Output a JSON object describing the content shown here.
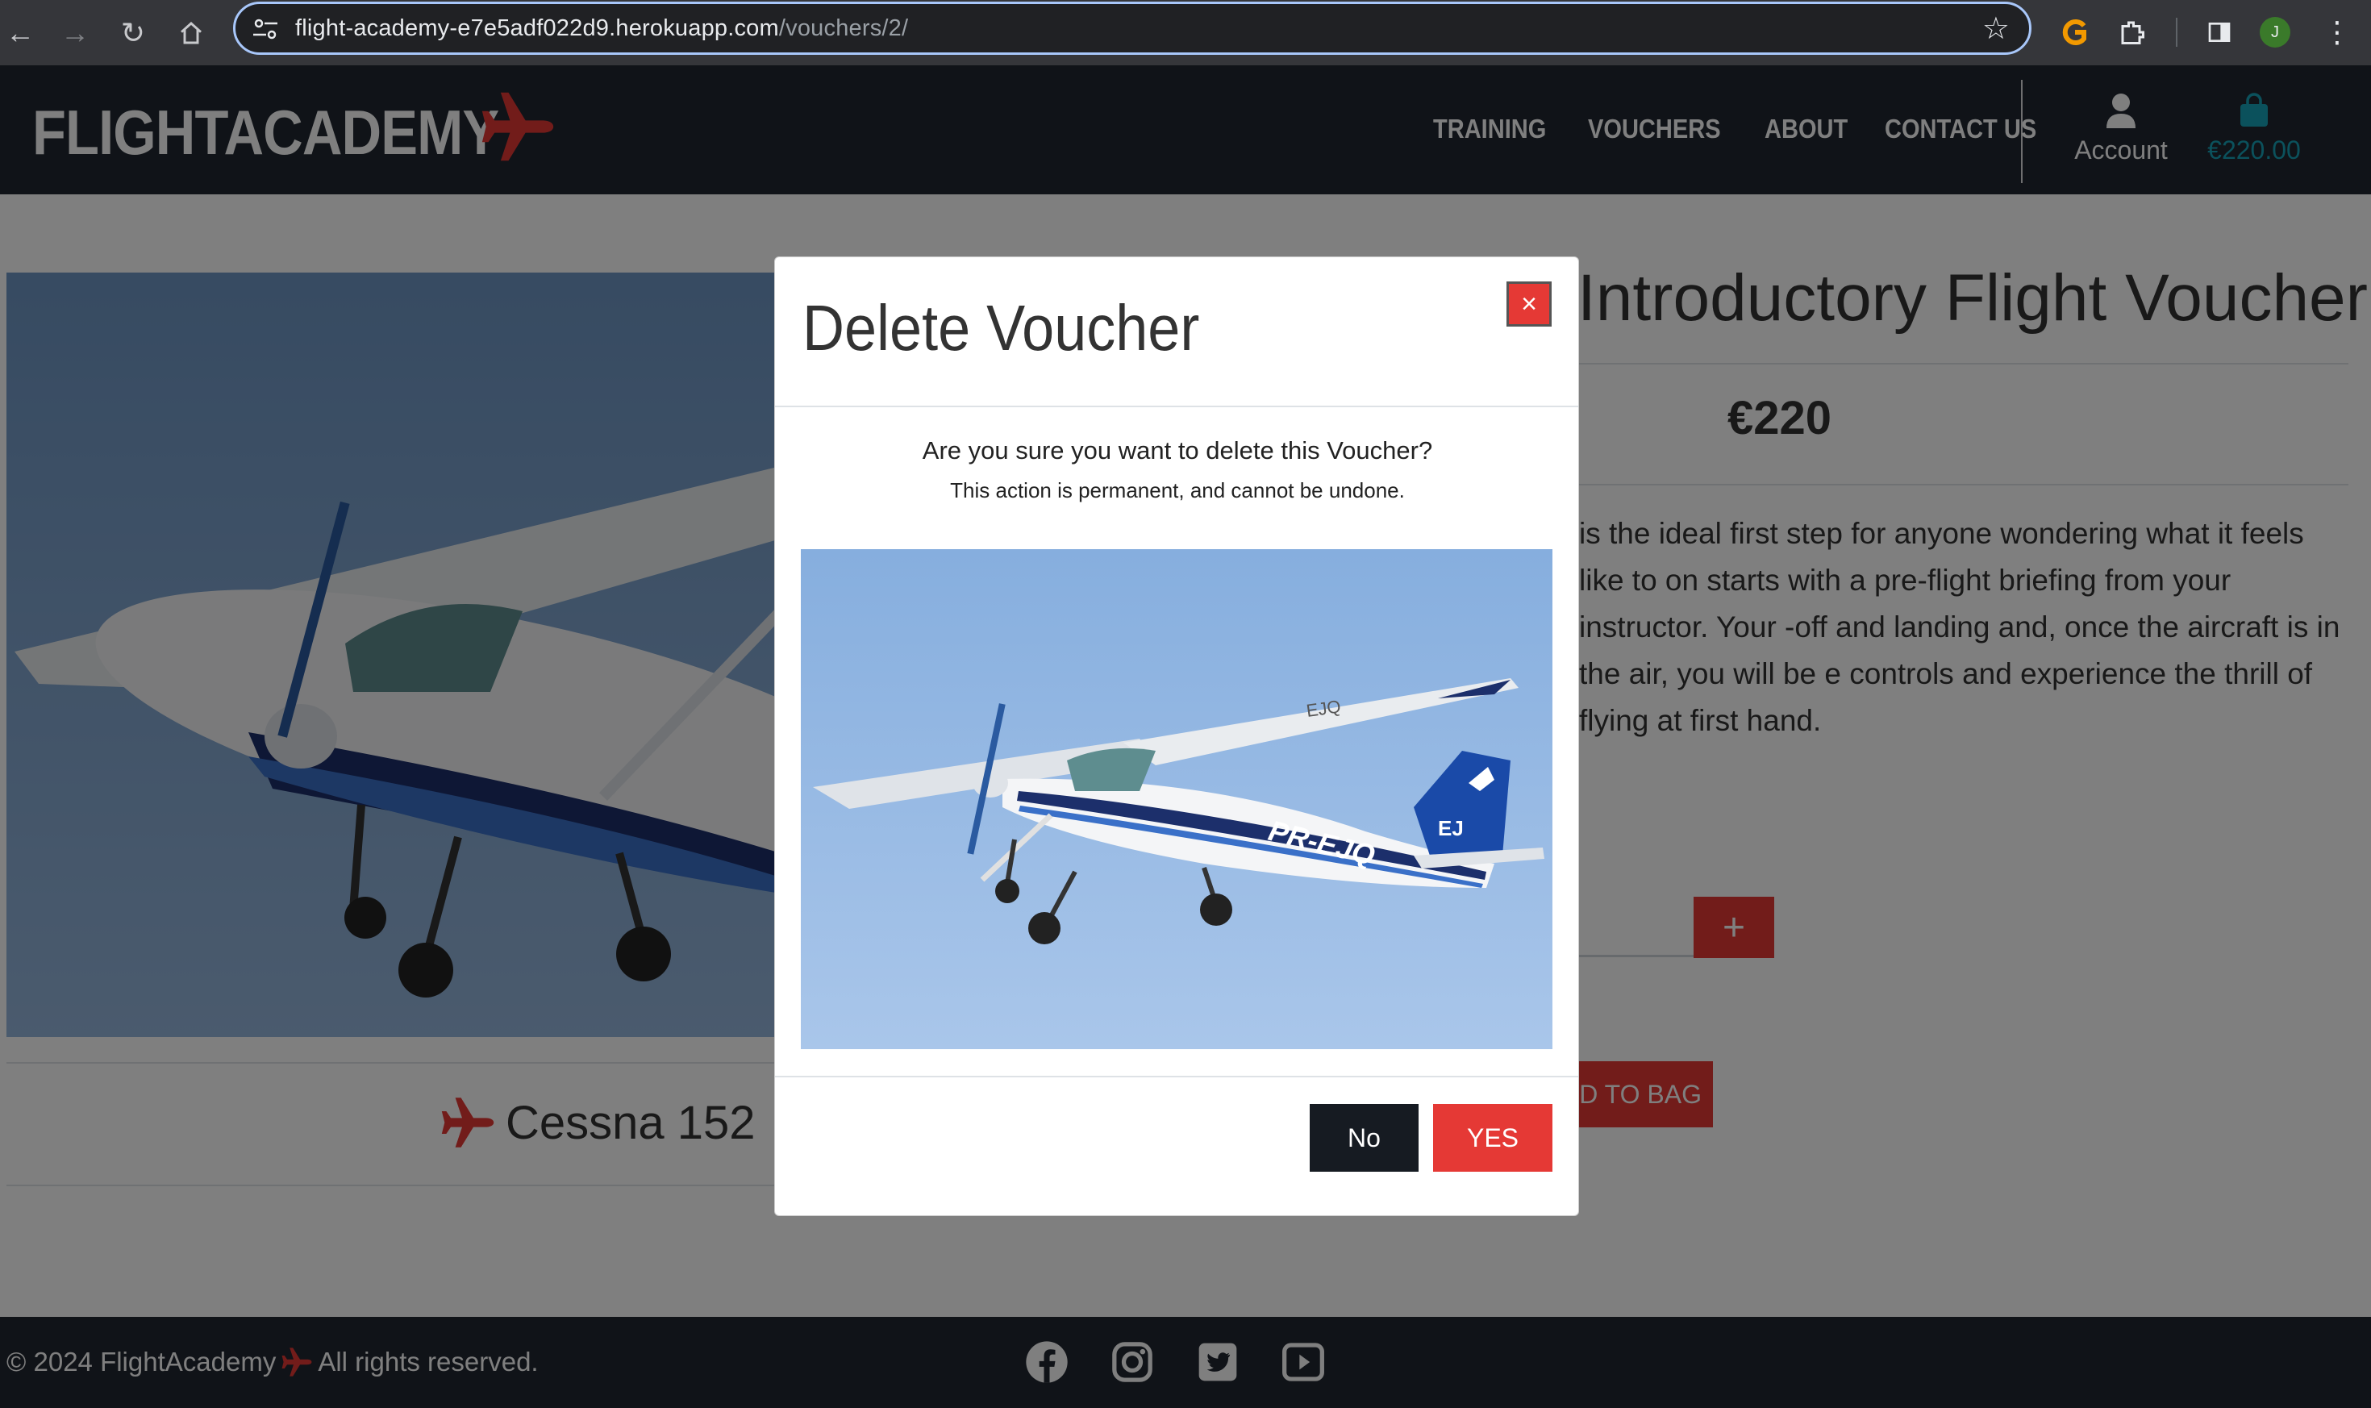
{
  "browser": {
    "url_host": "flight-academy-e7e5adf022d9.herokuapp.com",
    "url_path": "/vouchers/2/",
    "profile_initial": "J"
  },
  "header": {
    "logo_text": "FLIGHTACADEMY",
    "nav": [
      {
        "label": "TRAINING"
      },
      {
        "label": "VOUCHERS"
      },
      {
        "label": "ABOUT"
      },
      {
        "label": "CONTACT US"
      }
    ],
    "account_label": "Account",
    "bag_total": "€220.00"
  },
  "product": {
    "title": "Introductory Flight Voucher",
    "price": "€220",
    "description": "is the ideal first step for anyone wondering what it feels like to on starts with a pre-flight briefing from your instructor. Your -off and landing and, once the aircraft is in the air, you will be e controls and experience the thrill of flying at first hand.",
    "aircraft": "Cessna 152",
    "plus_label": "+",
    "add_to_bag_label": "D TO BAG",
    "registration": "PR-EJQ"
  },
  "modal": {
    "title": "Delete Voucher",
    "close_symbol": "×",
    "question": "Are you sure you want to delete this Voucher?",
    "warning": "This action is permanent, and cannot be undone.",
    "no_label": "No",
    "yes_label": "YES"
  },
  "footer": {
    "copyright_prefix": "© 2024 FlightAcademy",
    "copyright_suffix": "All rights reserved.",
    "socials": [
      "facebook-icon",
      "instagram-icon",
      "twitter-icon",
      "youtube-icon"
    ]
  },
  "colors": {
    "brand_red": "#e53935",
    "header_bg": "#212731",
    "bag_teal": "#17a2b8"
  }
}
